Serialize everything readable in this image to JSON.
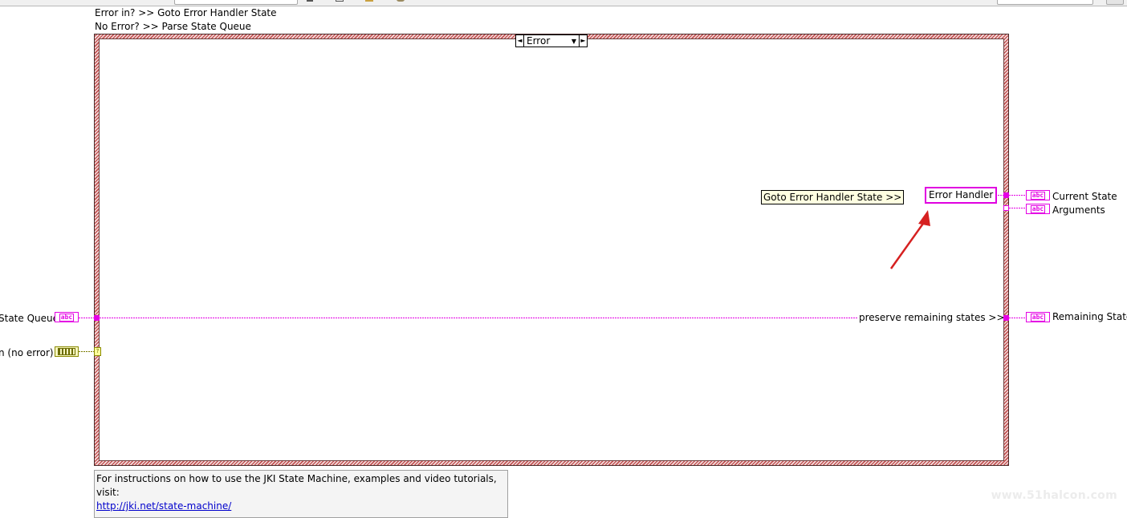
{
  "diagram_comments": {
    "header_line_1": "Error in? >> Goto Error Handler State",
    "header_line_2": "No Error? >> Parse State Queue"
  },
  "case_structure": {
    "selector_value": "Error",
    "decrement_glyph": "◄",
    "dropdown_glyph": "▼",
    "increment_glyph": "►"
  },
  "free_label": "Goto Error Handler State >>",
  "string_constant": "Error Handler",
  "preserve_label": "preserve remaining states >>",
  "inputs": {
    "state_queue_label": "State Queue",
    "error_in_label": "n (no error)"
  },
  "outputs": {
    "current_state_label": "Current State",
    "arguments_label": "Arguments",
    "remaining_states_label": "Remaining State"
  },
  "terminal_glyph": "abc",
  "unwired_glyph": "?",
  "instructions": {
    "text": "For instructions on how to use the JKI State Machine, examples and video tutorials, visit:",
    "link": "http://jki.net/state-machine/"
  },
  "watermark": "www.51halcon.com",
  "colors": {
    "string_wire": "#e400e4",
    "case_border": "#c55555",
    "error_cluster": "#8a8a00",
    "annotation_arrow": "#d62020",
    "comment_bg": "#ffffe1"
  },
  "icons": [
    "case-selector-decrement-icon",
    "case-selector-dropdown-icon",
    "case-selector-increment-icon",
    "annotation-arrow-icon",
    "string-terminal-icon",
    "cluster-terminal-icon"
  ]
}
